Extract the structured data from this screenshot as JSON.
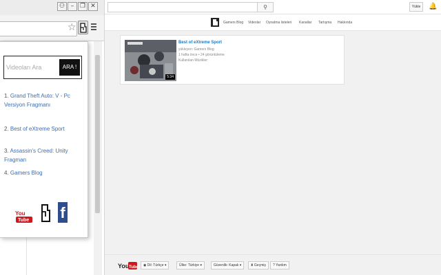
{
  "browser": {
    "window_buttons": {
      "user": "⚇",
      "minimize": "–",
      "restore": "❐",
      "close": "✕"
    },
    "star_icon": "☆"
  },
  "popup": {
    "search_placeholder": "Videoları Ara",
    "search_button": "ARA !",
    "results": [
      {
        "num": "1.",
        "label": "Grand Theft Auto: V - Pc Versiyon Fragmanı"
      },
      {
        "num": "2.",
        "label": "Best of eXtreme Sport"
      },
      {
        "num": "3.",
        "label": "Assassin's Creed: Unity Fragman"
      },
      {
        "num": "4.",
        "label": "Gamers Blog"
      }
    ]
  },
  "youtube": {
    "search_icon": "⚲",
    "upload_label": "Yükle",
    "bell_icon": "🔔",
    "nav": [
      "Gamers Blog",
      "Videolar",
      "Oynatma listeleri",
      "Kanallar",
      "Tartışma",
      "Hakkında"
    ],
    "video": {
      "title": "Best of eXtreme Sport",
      "uploader": "yükleyen: Gamers Blog",
      "stats": "1 hafta önce • 24 görüntüleme",
      "music": "Kullanılan Müzikler:",
      "duration": "5:34"
    },
    "footer": {
      "language": "Dil: Türkçe ▾",
      "country": "Ülke: Türkiye ▾",
      "safety": "Güvenlik: Kapalı ▾",
      "history": "Geçmiş",
      "help": "Yardım"
    }
  },
  "colors": {
    "youtube_red": "#cc181e",
    "link_blue": "#3a6db5",
    "facebook_blue": "#2e4d8f"
  }
}
